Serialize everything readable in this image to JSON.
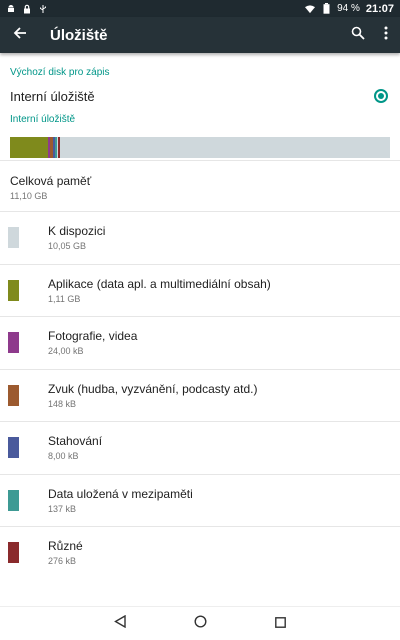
{
  "status_bar": {
    "battery_percent": "94 %",
    "time": "21:07",
    "icons": [
      "android-icon",
      "lock-icon",
      "usb-icon",
      "wifi-icon",
      "battery-icon"
    ]
  },
  "toolbar": {
    "title": "Úložiště",
    "icons": [
      "back-arrow-icon",
      "search-icon",
      "more-vert-icon"
    ]
  },
  "write_disk": {
    "header": "Výchozí disk pro zápis",
    "option_label": "Interní úložiště",
    "selected": true
  },
  "internal_storage": {
    "header": "Interní úložiště",
    "usage_bar": [
      {
        "category": "Aplikace (data apl. a multimediální obsah)",
        "fraction": 0.1,
        "color": "#7f8a1c"
      },
      {
        "category": "Fotografie, videa",
        "fraction": 0.006,
        "color": "#8e3a8c"
      },
      {
        "category": "Zvuk (hudba, vyzvánění, podcasty atd.)",
        "fraction": 0.007,
        "color": "#9c5a2f"
      },
      {
        "category": "Stahování",
        "fraction": 0.006,
        "color": "#4a5a9c"
      },
      {
        "category": "Data uložená v mezipaměti",
        "fraction": 0.006,
        "color": "#3e9a94"
      },
      {
        "category": "Různé",
        "fraction": 0.007,
        "color": "#8a2a2c"
      }
    ],
    "free_color": "#cfd8dc"
  },
  "total": {
    "label": "Celková paměť",
    "value": "11,10 GB"
  },
  "categories": [
    {
      "name": "K dispozici",
      "size": "10,05 GB",
      "color": "#cfd8dc"
    },
    {
      "name": "Aplikace (data apl. a multimediální obsah)",
      "size": "1,11 GB",
      "color": "#7f8a1c"
    },
    {
      "name": "Fotografie, videa",
      "size": "24,00 kB",
      "color": "#8e3a8c"
    },
    {
      "name": "Zvuk (hudba, vyzvánění, podcasty atd.)",
      "size": "148 kB",
      "color": "#9c5a2f"
    },
    {
      "name": "Stahování",
      "size": "8,00 kB",
      "color": "#4a5a9c"
    },
    {
      "name": "Data uložená v mezipaměti",
      "size": "137 kB",
      "color": "#3e9a94"
    },
    {
      "name": "Různé",
      "size": "276 kB",
      "color": "#8a2a2c"
    }
  ],
  "nav_bar": {
    "icons": [
      "nav-back-icon",
      "nav-home-icon",
      "nav-recents-icon"
    ]
  },
  "colors": {
    "accent": "#009688",
    "toolbar": "#263238",
    "status_bar": "#1f2a30"
  }
}
